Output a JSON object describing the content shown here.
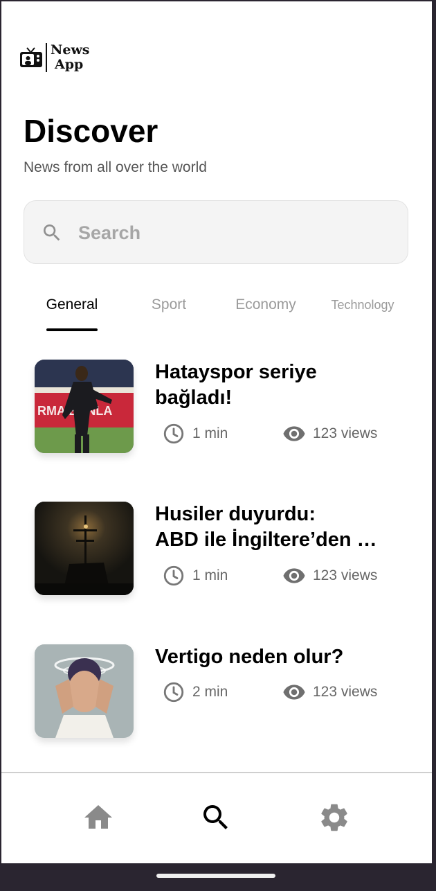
{
  "app": {
    "logo_line1": "News",
    "logo_line2": "App"
  },
  "header": {
    "title": "Discover",
    "subtitle": "News from all over the world"
  },
  "search": {
    "placeholder": "Search",
    "value": ""
  },
  "tabs": [
    {
      "label": "General",
      "active": true
    },
    {
      "label": "Sport",
      "active": false
    },
    {
      "label": "Economy",
      "active": false
    },
    {
      "label": "Technology",
      "active": false
    }
  ],
  "articles": [
    {
      "title": "Hatayspor seriye bağladı!",
      "title_line1": "Hatayspor seriye",
      "title_line2": "bağladı!",
      "read_time": "1 min",
      "views": "123 views"
    },
    {
      "title": "Husiler duyurdu: ABD ile İngiltere’den …",
      "title_line1": "Husiler duyurdu:",
      "title_line2": "ABD ile İngiltere’den …",
      "read_time": "1 min",
      "views": "123 views"
    },
    {
      "title": "Vertigo neden olur?",
      "title_line1": "Vertigo neden olur?",
      "read_time": "2 min",
      "views": "123 views"
    }
  ],
  "bottom_nav": [
    {
      "icon": "home-icon",
      "active": false
    },
    {
      "icon": "search-icon",
      "active": true
    },
    {
      "icon": "gear-icon",
      "active": false
    }
  ],
  "colors": {
    "active": "#000000",
    "inactive": "#8a8a8a",
    "meta": "#666666",
    "search_bg": "#f4f4f4"
  }
}
